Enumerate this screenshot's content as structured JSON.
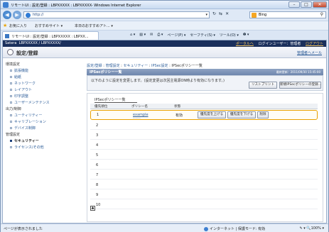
{
  "window": {
    "title": "リモートUI : 設定/登録 : LBPXXXXX : LBPXXXXX- Windows Internet Explorer",
    "minimize": "–",
    "maximize": "□",
    "close": "✕"
  },
  "address": {
    "url": "http://",
    "search_placeholder": "Bing",
    "search_icon": "search-icon",
    "dropdown": "▾"
  },
  "nav": {
    "back": "◀",
    "forward": "▶",
    "refresh": "↻",
    "stop": "✕",
    "feed": "⇆"
  },
  "favorites": {
    "favorites_label": "お気に入り",
    "suggested_sites": "おすすめサイト ▾",
    "today_recommend": "本日のおすすめアト... ▾"
  },
  "tab": {
    "label": "リモートUI : 設定/登録 : LBPXXXXX : LBPXX..."
  },
  "commands": {
    "home": "⌂ ▾",
    "feeds": "▧ ▾",
    "mail": "✉",
    "print": "⎙ ▾",
    "page": "ページ(P) ▾",
    "safety": "セーフティ(S) ▾",
    "tools": "ツール(O) ▾",
    "help": "❷ ▾"
  },
  "page": {
    "brand": "Satera",
    "device": "LBPXXXXX / LBPXXXXX/",
    "portal_link": "ポータルへ",
    "login_user": "ログインユーザー：管理者",
    "logout": "ログアウト",
    "title": "設定/登録",
    "mgmt_mail": "管理者へメール"
  },
  "sidebar": {
    "cat1": "環境設定",
    "items1": [
      "拡張機能",
      "給紙",
      "ネットワーク",
      "レイアウト",
      "印字調整",
      "ユーザーメンテナンス"
    ],
    "cat2": "出力/制御",
    "items2": [
      "ユーティリティー",
      "キャリブレーション",
      "デバイス制御"
    ],
    "cat3": "管理設定",
    "items3": [
      "セキュリティー",
      "ライセンス/その他"
    ]
  },
  "breadcrumb": {
    "part1": "設定/登録",
    "part2": "管理設定",
    "part3": "セキュリティー",
    "part4": "IPSec設定",
    "current": "IPSecポリシー一覧",
    "sep": " : "
  },
  "panel": {
    "title": "IPSecポリシー一覧",
    "updated": "最終更新：2011/09/30 15:45:00",
    "message": "以下のように設定を変更します。(設定変更は次回主電源ON時より有効になります。)",
    "register_list_button": "リストプリント",
    "new_policy_button": "新規IPSecポリシーの登録..."
  },
  "list": {
    "heading": "IPSecポリシー一覧",
    "columns": [
      "優先順位",
      "ポリシー名",
      "状態"
    ],
    "rows": [
      {
        "num": "1",
        "policy": "example",
        "policy_sub": "----------",
        "status": "有効"
      },
      {
        "num": "2"
      },
      {
        "num": "3"
      },
      {
        "num": "4"
      },
      {
        "num": "5"
      },
      {
        "num": "6"
      },
      {
        "num": "7"
      },
      {
        "num": "8"
      },
      {
        "num": "9"
      },
      {
        "num": "10"
      }
    ],
    "raise_button": "優先度を上げる",
    "lower_button": "優先度を下げる",
    "delete_button": "削除",
    "top_icon": "▲"
  },
  "status": {
    "left": "ページが表示されました",
    "zone": "インターネット | 保護モード: 有効",
    "zoom": "✎ ▾  🔍100% ▾"
  }
}
